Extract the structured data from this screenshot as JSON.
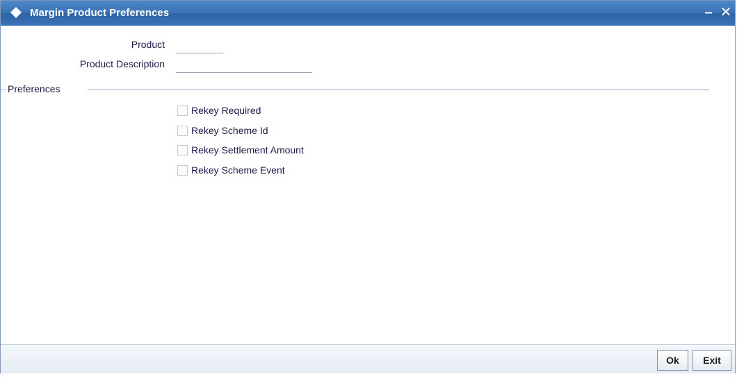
{
  "window": {
    "title": "Margin Product Preferences",
    "minimize_label": "–",
    "close_label": "✕"
  },
  "fields": {
    "product_label": "Product",
    "product_value": "",
    "description_label": "Product Description",
    "description_value": ""
  },
  "preferences": {
    "section_title": "Preferences",
    "options": [
      {
        "label": "Rekey Required",
        "checked": false
      },
      {
        "label": "Rekey Scheme Id",
        "checked": false
      },
      {
        "label": "Rekey Settlement Amount",
        "checked": false
      },
      {
        "label": "Rekey Scheme Event",
        "checked": false
      }
    ]
  },
  "footer": {
    "ok_label": "Ok",
    "exit_label": "Exit"
  },
  "colors": {
    "title_bar": "#3a72b6",
    "text": "#1a1a4a"
  }
}
